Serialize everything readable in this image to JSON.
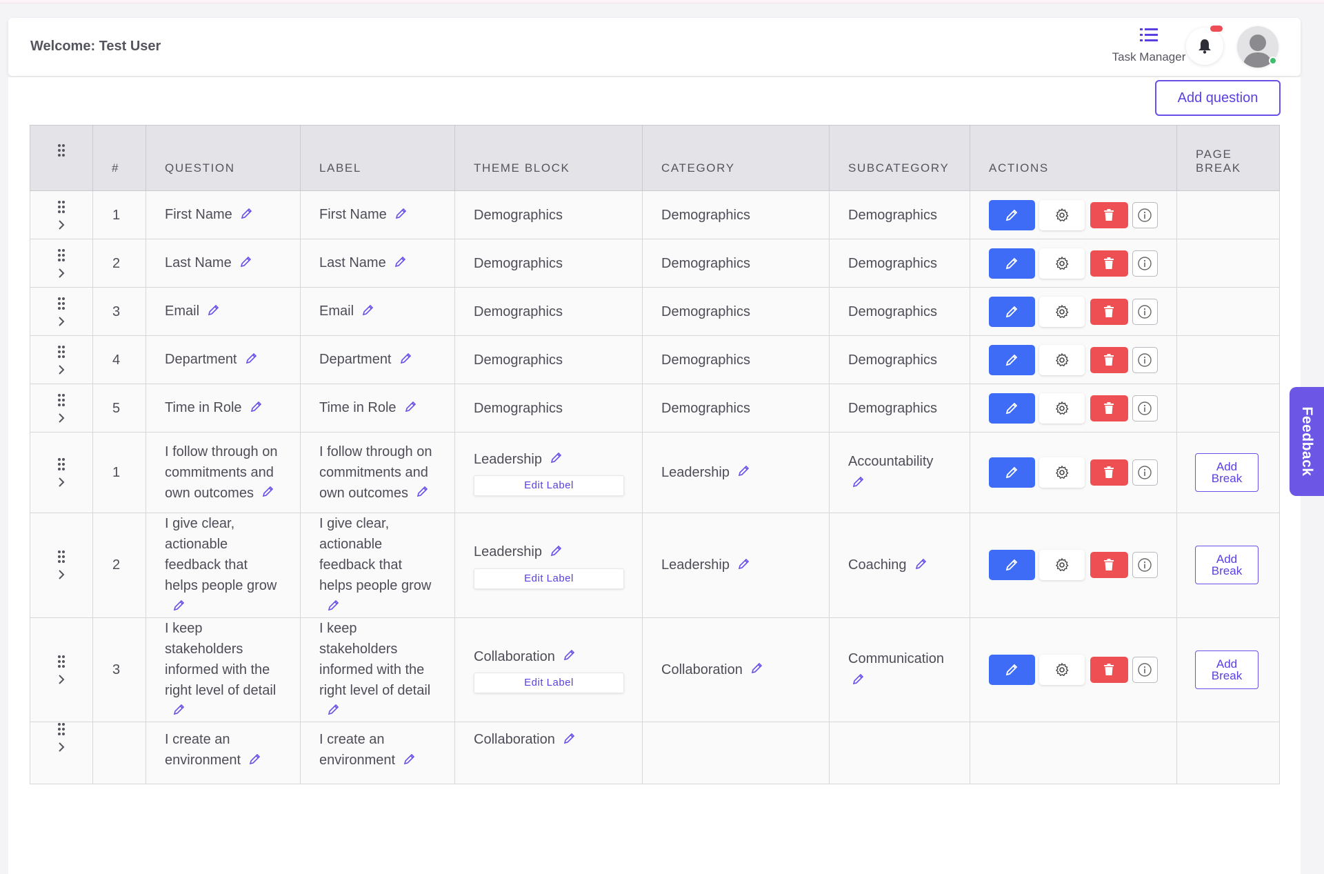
{
  "header": {
    "welcome": "Welcome: Test User",
    "task_manager_label": "Task Manager"
  },
  "toolbar": {
    "add_question_label": "Add question"
  },
  "table": {
    "columns": [
      "#",
      "QUESTION",
      "LABEL",
      "THEME BLOCK",
      "CATEGORY",
      "SUBCATEGORY",
      "ACTIONS",
      "PAGE BREAK"
    ],
    "rows": [
      {
        "num": "1",
        "question": "First Name",
        "label": "First Name",
        "theme": "Demographics",
        "category": "Demographics",
        "subcategory": "Demographics"
      },
      {
        "num": "2",
        "question": "Last Name",
        "label": "Last Name",
        "theme": "Demographics",
        "category": "Demographics",
        "subcategory": "Demographics"
      },
      {
        "num": "3",
        "question": "Email",
        "label": "Email",
        "theme": "Demographics",
        "category": "Demographics",
        "subcategory": "Demographics"
      },
      {
        "num": "4",
        "question": "Department",
        "label": "Department",
        "theme": "Demographics",
        "category": "Demographics",
        "subcategory": "Demographics"
      },
      {
        "num": "5",
        "question": "Time in Role",
        "label": "Time in Role",
        "theme": "Demographics",
        "category": "Demographics",
        "subcategory": "Demographics"
      },
      {
        "num": "1",
        "question": "I follow through on commitments and own outcomes",
        "label": "I follow through on commitments and own outcomes",
        "theme": "Leadership",
        "category": "Leadership",
        "subcategory": "Accountability",
        "edit_label": "Edit Label",
        "page_break": "Add Break"
      },
      {
        "num": "2",
        "question": "I give clear, actionable feedback that helps people grow",
        "label": "I give clear, actionable feedback that helps people grow",
        "theme": "Leadership",
        "category": "Leadership",
        "subcategory": "Coaching",
        "edit_label": "Edit Label",
        "page_break": "Add Break"
      },
      {
        "num": "3",
        "question": "I keep stakeholders informed with the right level of detail",
        "label": "I keep stakeholders informed with the right level of detail",
        "theme": "Collaboration",
        "category": "Collaboration",
        "subcategory": "Communication",
        "edit_label": "Edit Label",
        "page_break": "Add Break"
      },
      {
        "num": "",
        "question": "I create an environment",
        "label": "I create an environment",
        "theme": "Collaboration",
        "category": "",
        "subcategory": "",
        "page_break": ""
      }
    ]
  },
  "feedback_tab": {
    "label": "Feedback"
  },
  "colors": {
    "accent": "#5b3fe0",
    "edit_btn": "#3e6cf6",
    "delete_btn": "#ee4f52",
    "header_bg": "#e4e4e8"
  },
  "icons": [
    "list-icon",
    "bell-icon",
    "avatar-icon",
    "drag-handle-icon",
    "chevron-right-icon",
    "pencil-icon",
    "gear-icon",
    "trash-icon",
    "info-icon"
  ]
}
